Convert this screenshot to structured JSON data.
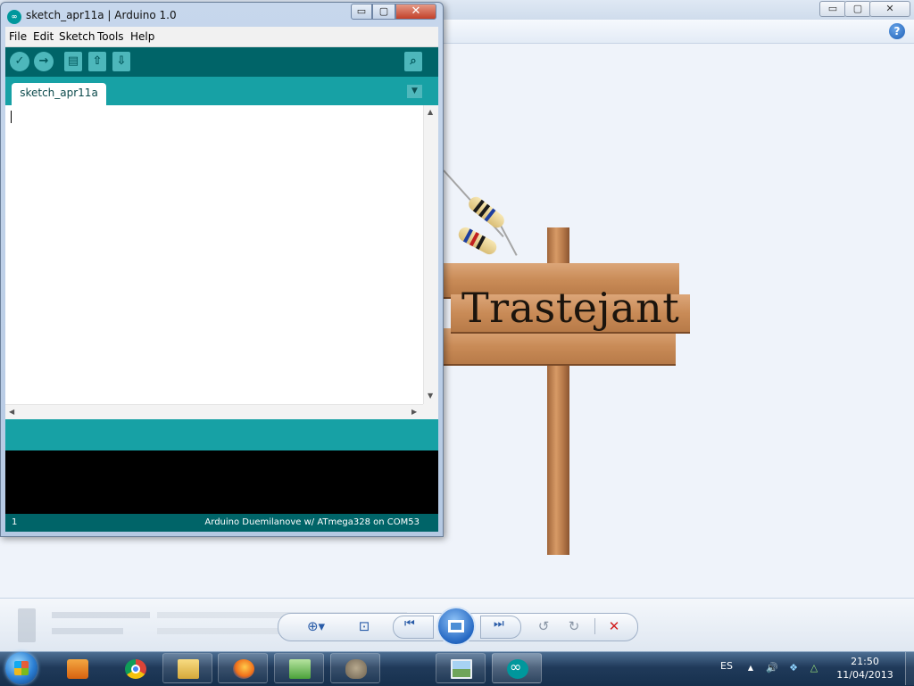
{
  "arduino": {
    "title": "sketch_apr11a | Arduino 1.0",
    "app_icon": "∞",
    "controls": {
      "minimize": "▭",
      "maximize": "▢",
      "close": "✕"
    },
    "menu": [
      "File",
      "Edit",
      "Sketch",
      "Tools",
      "Help"
    ],
    "toolbar": {
      "verify_icon": "✓",
      "upload_icon": "→",
      "new_icon": "▤",
      "open_icon": "⇧",
      "save_icon": "⇩",
      "serial_icon": "⌕"
    },
    "tab_label": "sketch_apr11a",
    "tab_menu_icon": "▼",
    "status_line": "1",
    "status_board": "Arduino Duemilanove w/ ATmega328 on COM53"
  },
  "viewer": {
    "sign_text": "Trastejant",
    "help_icon": "?",
    "controls": {
      "minimize": "▭",
      "maximize": "▢",
      "close": "✕"
    },
    "player": {
      "zoom_icon": "⊕▾",
      "fit_icon": "⊡",
      "prev_icon": "⏮",
      "next_icon": "⏭",
      "rotate_ccw_icon": "↺",
      "rotate_cw_icon": "↻",
      "delete_icon": "✕"
    }
  },
  "taskbar": {
    "language": "ES",
    "tray_icons": {
      "up_arrow": "▲",
      "volume": "🔊",
      "dropbox": "❖",
      "drive": "△"
    },
    "time": "21:50",
    "date": "11/04/2013"
  }
}
